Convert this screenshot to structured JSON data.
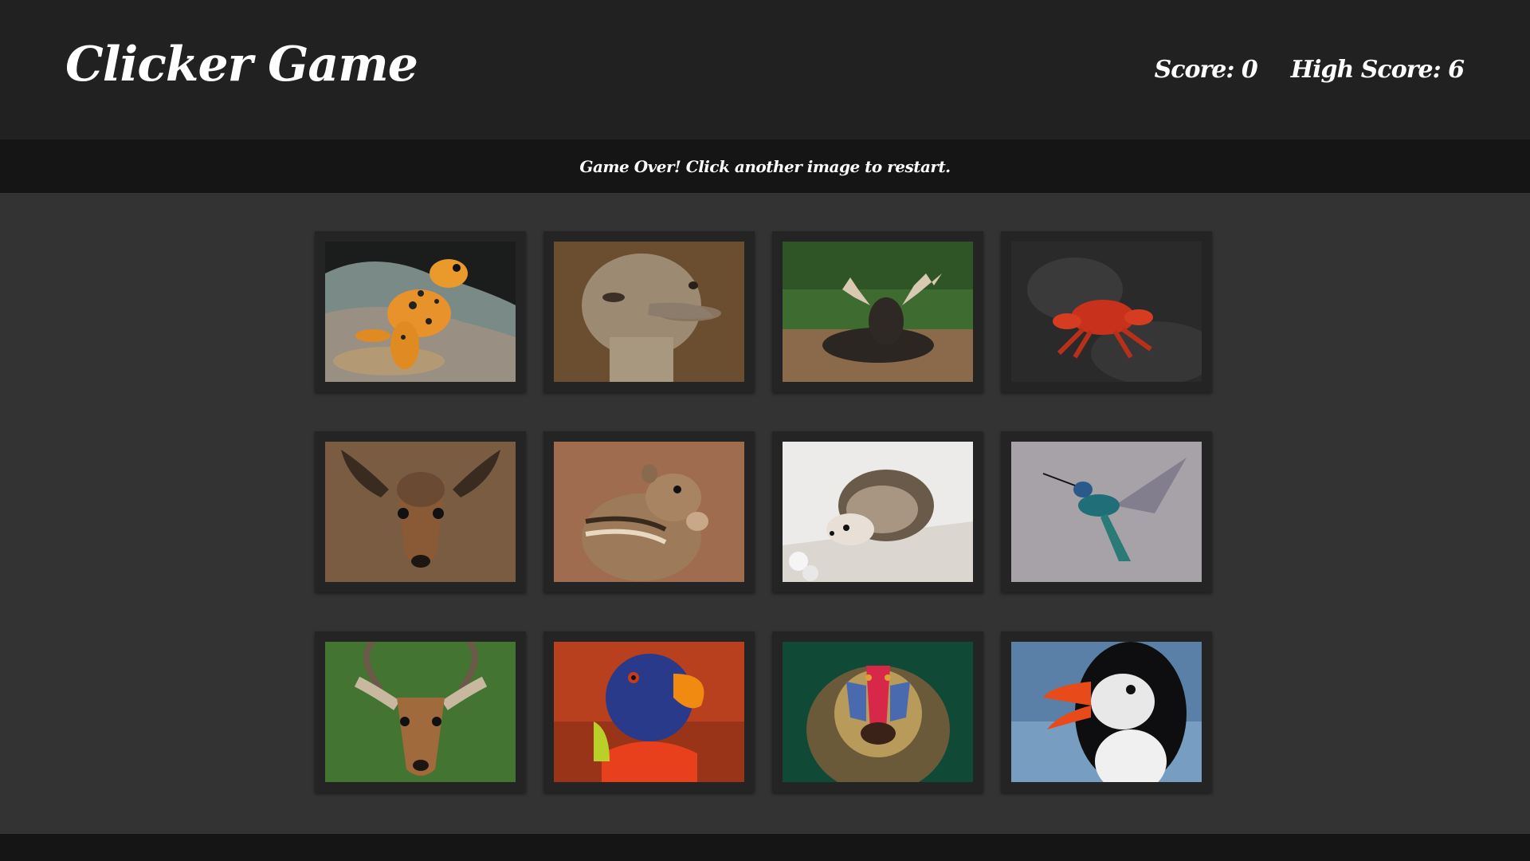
{
  "navbar": {
    "brand": "Clicker Game",
    "score_label": "Score: 0",
    "high_score_label": "High Score: 6"
  },
  "message": "Game Over! Click another image to restart.",
  "cards": [
    {
      "animal": "frog"
    },
    {
      "animal": "ostrich"
    },
    {
      "animal": "moose"
    },
    {
      "animal": "crab"
    },
    {
      "animal": "dik-dik"
    },
    {
      "animal": "chipmunk"
    },
    {
      "animal": "hedgehog"
    },
    {
      "animal": "hummingbird"
    },
    {
      "animal": "impala"
    },
    {
      "animal": "lorikeet"
    },
    {
      "animal": "mandrill"
    },
    {
      "animal": "puffin"
    }
  ]
}
